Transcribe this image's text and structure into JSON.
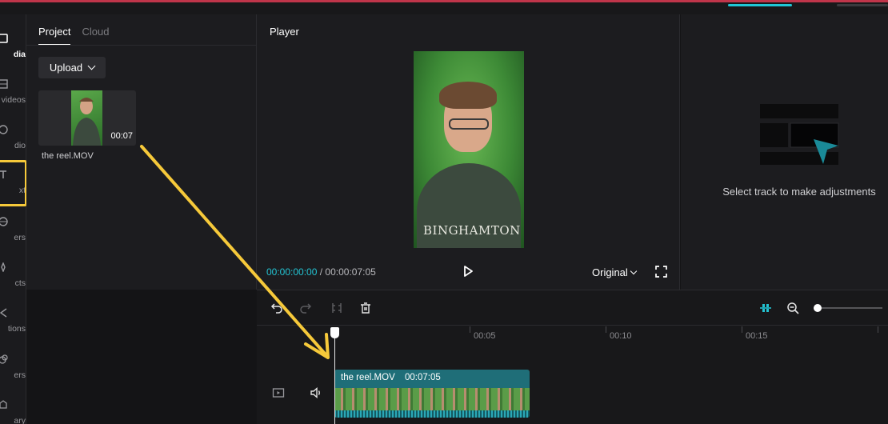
{
  "rail": {
    "items": [
      {
        "label": "dia",
        "icon": "media-icon"
      },
      {
        "label": "videos",
        "icon": "stock-videos-icon"
      },
      {
        "label": "dio",
        "icon": "audio-icon"
      },
      {
        "label": "xt",
        "icon": "text-icon"
      },
      {
        "label": "ers",
        "icon": "stickers-icon"
      },
      {
        "label": "cts",
        "icon": "effects-icon"
      },
      {
        "label": "tions",
        "icon": "transitions-icon"
      },
      {
        "label": "ers",
        "icon": "filters-icon"
      },
      {
        "label": "ary",
        "icon": "library-icon"
      }
    ]
  },
  "media": {
    "tabs": [
      "Project",
      "Cloud"
    ],
    "upload_label": "Upload",
    "clip": {
      "duration": "00:07",
      "name": "the reel.MOV"
    }
  },
  "player": {
    "title": "Player",
    "current_time": "00:00:00:00",
    "separator": " / ",
    "total_time": "00:00:07:05",
    "ratio_label": "Original",
    "hoodie_text": "BINGHAMTON"
  },
  "details": {
    "message": "Select track to make adjustments"
  },
  "timeline": {
    "ruler_labels": [
      "00:05",
      "00:10",
      "00:15"
    ],
    "clip": {
      "name": "the reel.MOV",
      "duration": "00:07:05"
    }
  },
  "colors": {
    "accent": "#23c3d2",
    "annotation": "#f6c93a",
    "clip": "#1f6e78"
  }
}
